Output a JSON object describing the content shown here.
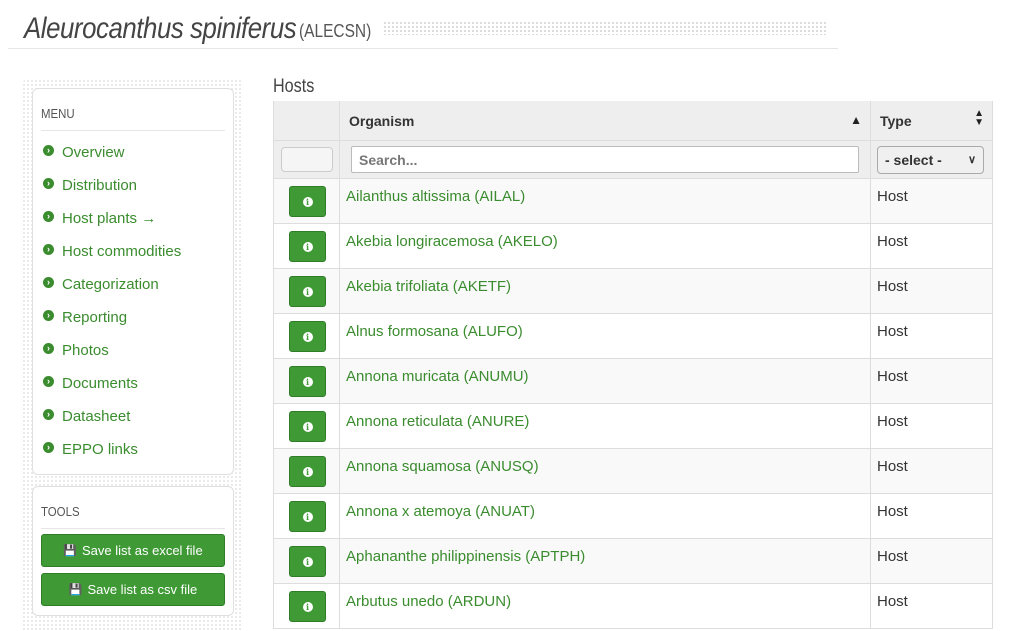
{
  "header": {
    "title": "Aleurocanthus spiniferus",
    "code": "(ALECSN)"
  },
  "sidebar": {
    "menu_title": "MENU",
    "items": [
      {
        "label": "Overview",
        "icon": "chevron-circle-right-icon"
      },
      {
        "label": "Distribution",
        "icon": "chevron-circle-right-icon"
      },
      {
        "label": "Host plants →",
        "icon": "chevron-circle-right-icon"
      },
      {
        "label": "Host commodities",
        "icon": "chevron-circle-right-icon"
      },
      {
        "label": "Categorization",
        "icon": "chevron-circle-right-icon"
      },
      {
        "label": "Reporting",
        "icon": "chevron-circle-right-icon"
      },
      {
        "label": "Photos",
        "icon": "chevron-circle-right-icon"
      },
      {
        "label": "Documents",
        "icon": "chevron-circle-right-icon"
      },
      {
        "label": "Datasheet",
        "icon": "chevron-circle-right-icon"
      },
      {
        "label": "EPPO links",
        "icon": "chevron-circle-right-icon"
      }
    ],
    "tools_title": "TOOLS",
    "tools": [
      {
        "label": "Save list as excel file",
        "icon": "floppy-disk-icon"
      },
      {
        "label": "Save list as csv file",
        "icon": "floppy-disk-icon"
      }
    ]
  },
  "hosts": {
    "heading": "Hosts",
    "columns": {
      "organism": "Organism",
      "type": "Type"
    },
    "search_placeholder": "Search...",
    "type_filter_value": "- select -",
    "rows": [
      {
        "organism": "Ailanthus altissima (AILAL)",
        "type": "Host"
      },
      {
        "organism": "Akebia longiracemosa (AKELO)",
        "type": "Host"
      },
      {
        "organism": "Akebia trifoliata (AKETF)",
        "type": "Host"
      },
      {
        "organism": "Alnus formosana (ALUFO)",
        "type": "Host"
      },
      {
        "organism": "Annona muricata (ANUMU)",
        "type": "Host"
      },
      {
        "organism": "Annona reticulata (ANURE)",
        "type": "Host"
      },
      {
        "organism": "Annona squamosa (ANUSQ)",
        "type": "Host"
      },
      {
        "organism": "Annona x atemoya (ANUAT)",
        "type": "Host"
      },
      {
        "organism": "Aphananthe philippinensis (APTPH)",
        "type": "Host"
      },
      {
        "organism": "Arbutus unedo (ARDUN)",
        "type": "Host"
      }
    ]
  },
  "colors": {
    "accent": "#3a8c2e",
    "button": "#3f9a36"
  }
}
